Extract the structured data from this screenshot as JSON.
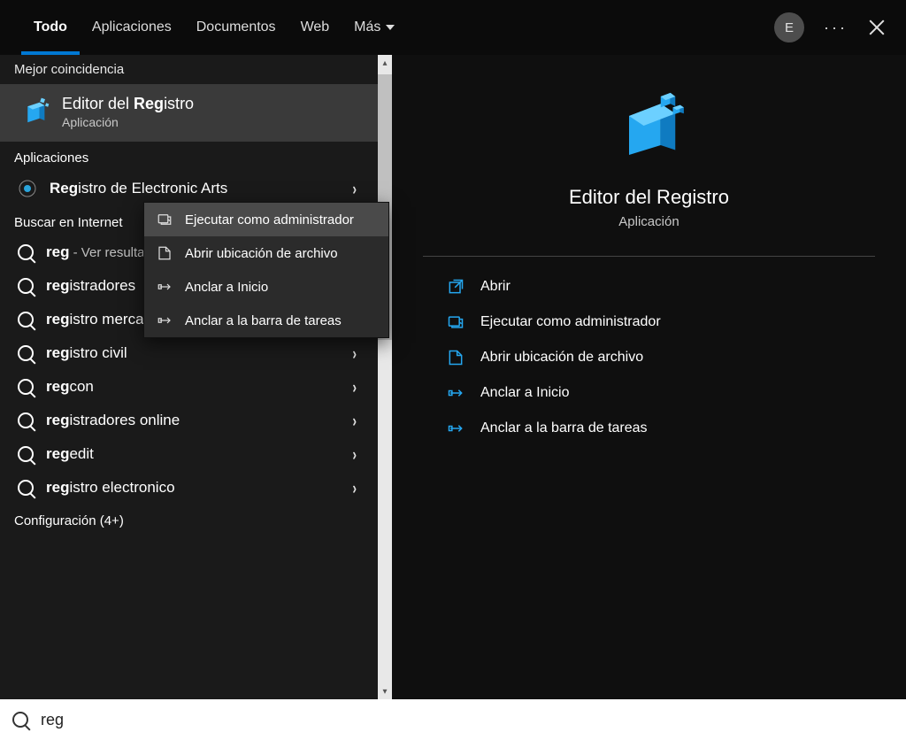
{
  "tabs": {
    "items": [
      "Todo",
      "Aplicaciones",
      "Documentos",
      "Web",
      "Más"
    ],
    "active_index": 0
  },
  "header": {
    "avatar_letter": "E",
    "more_dots": "···"
  },
  "left": {
    "best_match_header": "Mejor coincidencia",
    "best_match": {
      "title_prefix": "Editor del ",
      "title_match": "Reg",
      "title_rest": "istro",
      "subtitle": "Aplicación"
    },
    "apps_header": "Aplicaciones",
    "app_item": {
      "prefix": "",
      "match": "Reg",
      "rest": "istro de Electronic Arts"
    },
    "web_header": "Buscar en Internet",
    "web_items": [
      {
        "prefix": "",
        "match": "reg",
        "rest": "",
        "suffix": " - Ver resultados web"
      },
      {
        "prefix": "",
        "match": "reg",
        "rest": "istradores",
        "suffix": ""
      },
      {
        "prefix": "",
        "match": "reg",
        "rest": "istro mercantil",
        "suffix": ""
      },
      {
        "prefix": "",
        "match": "reg",
        "rest": "istro civil",
        "suffix": ""
      },
      {
        "prefix": "",
        "match": "reg",
        "rest": "con",
        "suffix": ""
      },
      {
        "prefix": "",
        "match": "reg",
        "rest": "istradores online",
        "suffix": ""
      },
      {
        "prefix": "",
        "match": "reg",
        "rest": "edit",
        "suffix": ""
      },
      {
        "prefix": "",
        "match": "reg",
        "rest": "istro electronico",
        "suffix": ""
      }
    ],
    "config_header": "Configuración (4+)"
  },
  "context_menu": {
    "items": [
      "Ejecutar como administrador",
      "Abrir ubicación de archivo",
      "Anclar a Inicio",
      "Anclar a la barra de tareas"
    ],
    "highlighted_index": 0
  },
  "right": {
    "title": "Editor del Registro",
    "subtitle": "Aplicación",
    "actions": [
      "Abrir",
      "Ejecutar como administrador",
      "Abrir ubicación de archivo",
      "Anclar a Inicio",
      "Anclar a la barra de tareas"
    ]
  },
  "search": {
    "value": "reg"
  },
  "colors": {
    "accent": "#0078d4",
    "icon_blue": "#25a7f0"
  }
}
